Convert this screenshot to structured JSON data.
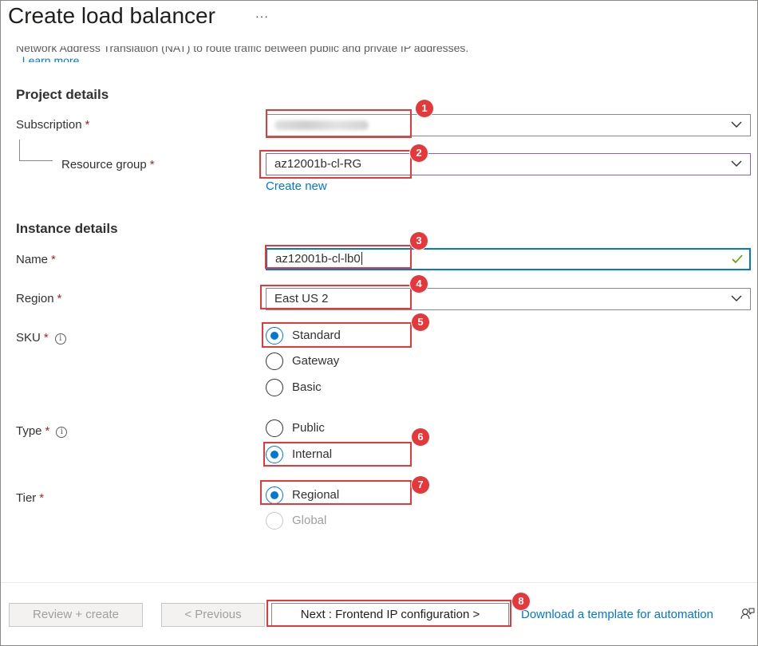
{
  "header": {
    "title": "Create load balancer",
    "more_label": "···"
  },
  "intro": {
    "text": "Network Address Translation (NAT) to route traffic between public and private IP addresses.",
    "link": "Learn more."
  },
  "project": {
    "heading": "Project details",
    "subscription": {
      "label": "Subscription",
      "required": "*"
    },
    "resource_group": {
      "label": "Resource group",
      "required": "*",
      "value": "az12001b-cl-RG",
      "create_new": "Create new"
    }
  },
  "instance": {
    "heading": "Instance details",
    "name": {
      "label": "Name",
      "required": "*",
      "value": "az12001b-cl-lb0"
    },
    "region": {
      "label": "Region",
      "required": "*",
      "value": "East US 2"
    },
    "sku": {
      "label": "SKU",
      "required": "*",
      "info": "i",
      "options": [
        "Standard",
        "Gateway",
        "Basic"
      ],
      "selected": "Standard"
    },
    "type": {
      "label": "Type",
      "required": "*",
      "info": "i",
      "options": [
        "Public",
        "Internal"
      ],
      "selected": "Internal"
    },
    "tier": {
      "label": "Tier",
      "required": "*",
      "options": [
        "Regional",
        "Global"
      ],
      "selected": "Regional"
    }
  },
  "annotations": [
    "1",
    "2",
    "3",
    "4",
    "5",
    "6",
    "7",
    "8"
  ],
  "footer": {
    "review_create": "Review + create",
    "previous": "< Previous",
    "next": "Next : Frontend IP configuration >",
    "download_template": "Download a template for automation",
    "feedback_icon": "feedback-icon"
  },
  "colors": {
    "accent": "#0078d4",
    "highlight": "#e5383b",
    "required": "#a4262c",
    "success": "#57a300"
  }
}
